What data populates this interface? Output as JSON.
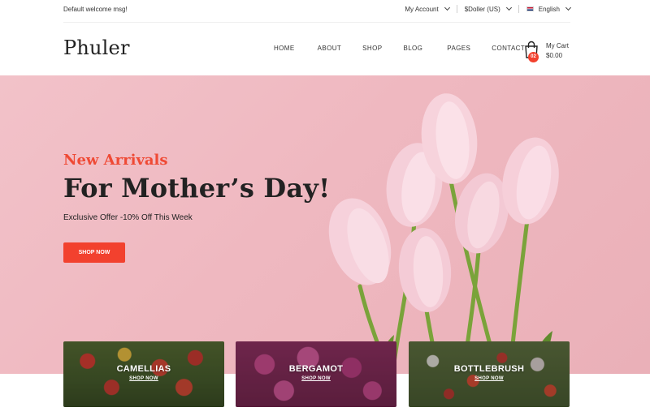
{
  "topbar": {
    "welcome": "Default welcome msg!",
    "account": "My Account",
    "currency": "$Doller (US)",
    "language": "English"
  },
  "header": {
    "logo": "Phuler",
    "nav": [
      "HOME",
      "ABOUT",
      "SHOP",
      "BLOG",
      "PAGES",
      "CONTACT"
    ],
    "cart": {
      "label": "My Cart",
      "total": "$0.00",
      "count": "02"
    }
  },
  "hero": {
    "kicker": "New Arrivals",
    "title": "For Mother’s Day!",
    "offer": "Exclusive Offer -10% Off This Week",
    "button": "SHOP NOW"
  },
  "categories": [
    {
      "name": "CAMELLIAS",
      "link": "SHOP NOW"
    },
    {
      "name": "BERGAMOT",
      "link": "SHOP NOW"
    },
    {
      "name": "BOTTLEBRUSH",
      "link": "SHOP NOW"
    }
  ],
  "colors": {
    "accent": "#f2412e",
    "hero_bg": "#efb8c0",
    "text": "#222222"
  }
}
